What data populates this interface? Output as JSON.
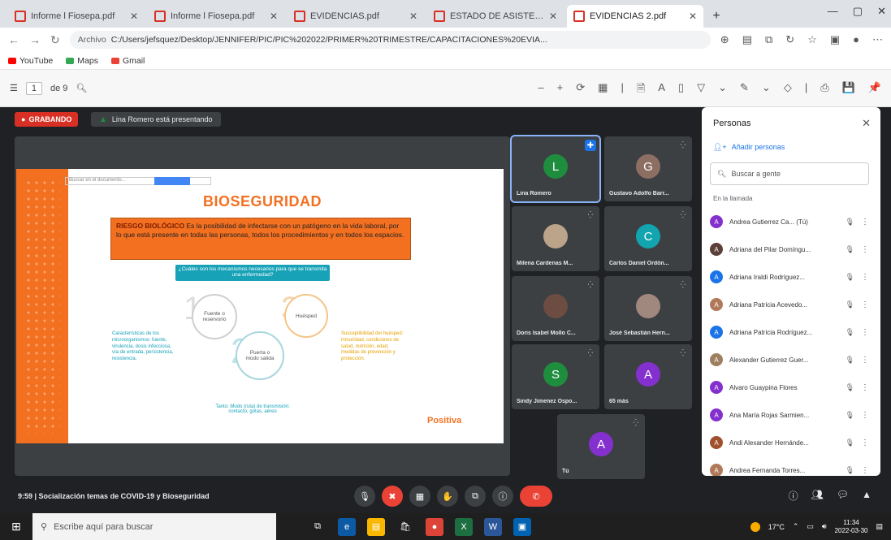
{
  "browser": {
    "tabs": [
      {
        "label": "Informe l Fiosepa.pdf",
        "active": false
      },
      {
        "label": "Informe l Fiosepa.pdf",
        "active": false
      },
      {
        "label": "EVIDENCIAS.pdf",
        "active": false
      },
      {
        "label": "ESTADO DE ASISTENCIA...",
        "active": false
      },
      {
        "label": "EVIDENCIAS 2.pdf",
        "active": true
      }
    ],
    "url_tag": "Archivo",
    "url": "C:/Users/jefsquez/Desktop/JENNIFER/PIC/PIC%202022/PRIMER%20TRIMESTRE/CAPACITACIONES%20EVIA...",
    "bookmarks": [
      {
        "label": "YouTube",
        "color": "#ff0000"
      },
      {
        "label": "Maps",
        "color": "#34a853"
      },
      {
        "label": "Gmail",
        "color": "#ea4335"
      }
    ]
  },
  "pdf_toolbar": {
    "page_current": "1",
    "page_total": "de 9",
    "tools": [
      "–",
      "+",
      "⟳",
      "▦",
      "|",
      "🗎",
      "A",
      "▯",
      "▽",
      "⌄",
      "✎",
      "⌄",
      "◇",
      "|",
      "⎙",
      "💾",
      "📌"
    ]
  },
  "meet": {
    "recording_label": "GRABANDO",
    "presenting_label": "Lina Romero está presentando",
    "bottom_info": "9:59  |  Socialización temas de COVID-19 y Bioseguridad",
    "slide": {
      "search_placeholder": "Buscar en el documento...",
      "title": "BIOSEGURIDAD",
      "definition_bold": "RIESGO BIOLÓGICO",
      "definition_text": " Es la posibilidad de infectarse con un patógeno en la vida laboral, por lo que está presente en todas las personas, todos los procedimientos y en todos los espacios.",
      "question": "¿Cuáles son los mecanismos necesarios para que se transmita una enfermedad?",
      "circle1": "Fuente o reservorio",
      "circle2": "Puerta o modo salida",
      "circle3": "Huésped",
      "left_note": "Características de los microorganismos: fuente, virulencia, dosis infecciosa, vía de entrada, persistencia, resistencia.",
      "right_note": "Susceptibilidad del huésped: inmunidad, condiciones de salud, nutrición, edad, medidas de prevención y protección.",
      "bottom_note": "Tanto: Modo (ruta) de transmisión: contacto, gotas, aéreo",
      "logo": "Positiva"
    },
    "participants": [
      {
        "initial": "L",
        "name": "Lina Romero",
        "color": "#1e8e3e",
        "pinned": true
      },
      {
        "initial": "G",
        "name": "Gustavo Adolfo Barr...",
        "color": "#8d6e63"
      },
      {
        "initial": "",
        "name": "Milena Cardenas M...",
        "color": "#bca48a",
        "photo": true
      },
      {
        "initial": "C",
        "name": "Carlos Daniel Ordón...",
        "color": "#12a4af"
      },
      {
        "initial": "",
        "name": "Doris Isabel Mollo C...",
        "color": "#6d4c41",
        "photo": true
      },
      {
        "initial": "",
        "name": "José Sebastián Hern...",
        "color": "#a1887f",
        "photo": true
      },
      {
        "initial": "S",
        "name": "Sindy Jimenez Ospo...",
        "color": "#1e8e3e"
      },
      {
        "initial": "A",
        "name": "65 más",
        "color": "#8430ce"
      },
      {
        "initial": "A",
        "name": "Tú",
        "color": "#8430ce"
      }
    ],
    "controls": [
      "🎙",
      "✖",
      "▦",
      "✋",
      "⧉",
      "ⓘ",
      "✆"
    ],
    "people_panel": {
      "title": "Personas",
      "add_label": "Añadir personas",
      "search_placeholder": "Buscar a gente",
      "section": "En la llamada",
      "list": [
        {
          "initial": "A",
          "name": "Andrea Gutierrez Ca... (Tú)",
          "color": "#8430ce"
        },
        {
          "initial": "A",
          "name": "Adriana del Pilar Domíngu...",
          "color": "#5d4037"
        },
        {
          "initial": "A",
          "name": "Adriana Iraldi Rodríguez...",
          "color": "#1a73e8"
        },
        {
          "initial": "A",
          "name": "Adriana Patricia Acevedo...",
          "color": "#b07a5a"
        },
        {
          "initial": "A",
          "name": "Adriana Patricia Rodríguez...",
          "color": "#1a73e8"
        },
        {
          "initial": "A",
          "name": "Alexander Gutierrez Guer...",
          "color": "#9e8060"
        },
        {
          "initial": "A",
          "name": "Alvaro Guaypina Flores",
          "color": "#8430ce"
        },
        {
          "initial": "A",
          "name": "Ana María Rojas Sarmien...",
          "color": "#8430ce"
        },
        {
          "initial": "A",
          "name": "Andi Alexander Hernánde...",
          "color": "#a0522d"
        },
        {
          "initial": "A",
          "name": "Andrea Fernanda Torres...",
          "color": "#b07a5a"
        }
      ]
    }
  },
  "taskbar": {
    "search_placeholder": "Escribe aquí para buscar",
    "weather": "17°C",
    "time": "11:34",
    "date": "2022-03-30",
    "apps": [
      {
        "icon": "task-view-icon",
        "color": "#1f1f1f",
        "glyph": "⧉"
      },
      {
        "icon": "edge-icon",
        "color": "#0c59a4",
        "glyph": "e"
      },
      {
        "icon": "explorer-icon",
        "color": "#f9b700",
        "glyph": "▤"
      },
      {
        "icon": "store-icon",
        "color": "#1f1f1f",
        "glyph": "🛍"
      },
      {
        "icon": "chrome-icon",
        "color": "#db4437",
        "glyph": "●"
      },
      {
        "icon": "excel-icon",
        "color": "#1d6f42",
        "glyph": "X"
      },
      {
        "icon": "word-icon",
        "color": "#2b579a",
        "glyph": "W"
      },
      {
        "icon": "photos-icon",
        "color": "#0063b1",
        "glyph": "▣"
      }
    ]
  }
}
